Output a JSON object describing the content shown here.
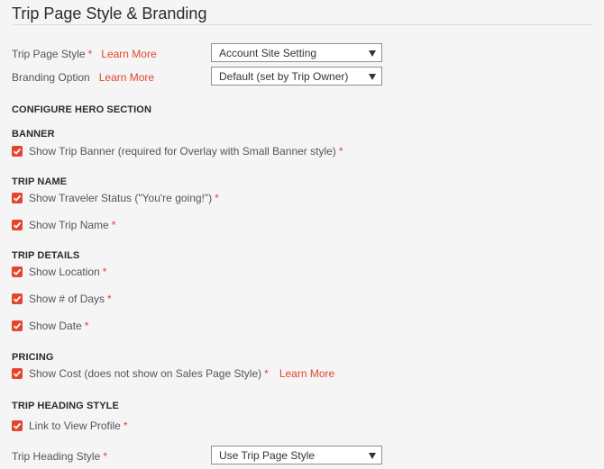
{
  "page": {
    "title": "Trip Page Style & Branding"
  },
  "fields": {
    "trip_page_style": {
      "label": "Trip Page Style",
      "learn_more": "Learn More",
      "value": "Account Site Setting"
    },
    "branding_option": {
      "label": "Branding Option",
      "learn_more": "Learn More",
      "value": "Default (set by Trip Owner)"
    },
    "trip_heading_style": {
      "label": "Trip Heading Style",
      "value": "Use Trip Page Style"
    }
  },
  "sections": {
    "hero": "CONFIGURE HERO SECTION",
    "banner": "BANNER",
    "trip_name": "TRIP NAME",
    "trip_details": "TRIP DETAILS",
    "pricing": "PRICING",
    "trip_heading_style": "TRIP HEADING STYLE"
  },
  "checks": {
    "show_trip_banner": "Show Trip Banner (required for Overlay with Small Banner style)",
    "show_traveler_status": "Show Traveler Status (\"You're going!\")",
    "show_trip_name": "Show Trip Name",
    "show_location": "Show Location",
    "show_days": "Show # of Days",
    "show_date": "Show Date",
    "show_cost": "Show Cost (does not show on Sales Page Style)",
    "show_cost_learn_more": "Learn More",
    "link_to_view_profile": "Link to View Profile"
  },
  "required_marker": "*",
  "colors": {
    "accent": "#e5452d"
  }
}
